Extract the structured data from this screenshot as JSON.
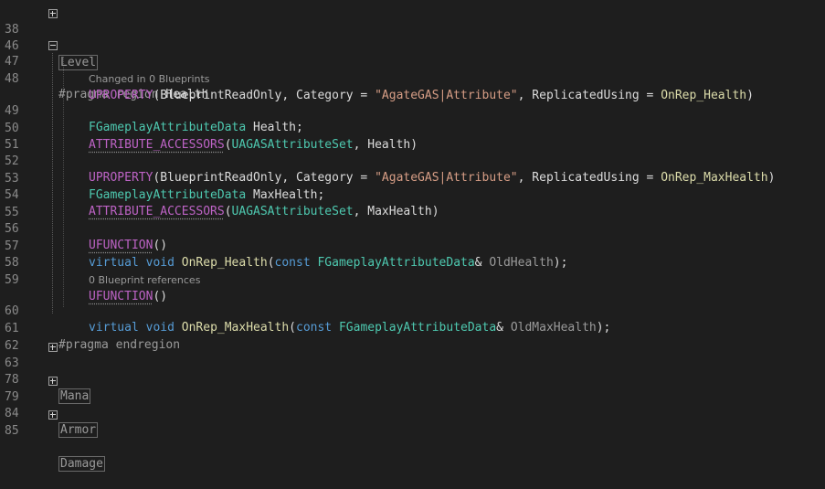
{
  "lines": [
    {
      "num": "38",
      "collapsed": "Level"
    },
    {
      "num": "46"
    },
    {
      "num": "47",
      "pragma": "#pragma region",
      "region_name": "Health"
    },
    {
      "num": "48",
      "uprop": "UPROPERTY",
      "open": "(BlueprintReadOnly, Category = ",
      "category": "\"AgateGAS|Attribute\"",
      "mid": ", ReplicatedUsing = ",
      "rep": "OnRep_Health",
      "close": ")"
    },
    {
      "num": "49",
      "type": "FGameplayAttributeData",
      "name": " Health;"
    },
    {
      "num": "50",
      "macro": "ATTRIBUTE_ACCESSORS",
      "open": "(",
      "cls": "UAGASAttributeSet",
      "rest": ", Health)"
    },
    {
      "num": "51"
    },
    {
      "num": "52",
      "uprop": "UPROPERTY",
      "open": "(BlueprintReadOnly, Category = ",
      "category": "\"AgateGAS|Attribute\"",
      "mid": ", ReplicatedUsing = ",
      "rep": "OnRep_MaxHealth",
      "close": ")"
    },
    {
      "num": "53",
      "type": "FGameplayAttributeData",
      "name": " MaxHealth;"
    },
    {
      "num": "54",
      "macro": "ATTRIBUTE_ACCESSORS",
      "open": "(",
      "cls": "UAGASAttributeSet",
      "rest": ", MaxHealth)"
    },
    {
      "num": "55"
    },
    {
      "num": "56",
      "ufunc": "UFUNCTION",
      "rest": "()"
    },
    {
      "num": "57",
      "virtual": "virtual",
      "void": "void",
      "fn": "OnRep_Health",
      "open": "(",
      "const": "const",
      "type": "FGameplayAttributeData",
      "amp": "& ",
      "param": "OldHealth",
      "close": ");"
    },
    {
      "num": "58"
    },
    {
      "num": "59",
      "ufunc": "UFUNCTION",
      "rest": "()"
    },
    {
      "num": "60",
      "virtual": "virtual",
      "void": "void",
      "fn": "OnRep_MaxHealth",
      "open": "(",
      "const": "const",
      "type": "FGameplayAttributeData",
      "amp": "& ",
      "param": "OldMaxHealth",
      "close": ");"
    },
    {
      "num": "61",
      "pragma": "#pragma endregion"
    },
    {
      "num": "62"
    },
    {
      "num": "63",
      "collapsed": "Mana"
    },
    {
      "num": "78"
    },
    {
      "num": "79",
      "collapsed": "Armor"
    },
    {
      "num": "84"
    },
    {
      "num": "85",
      "collapsed": "Damage"
    }
  ],
  "hints": {
    "changed": "Changed in 0 Blueprints",
    "references": "0 Blueprint references"
  }
}
